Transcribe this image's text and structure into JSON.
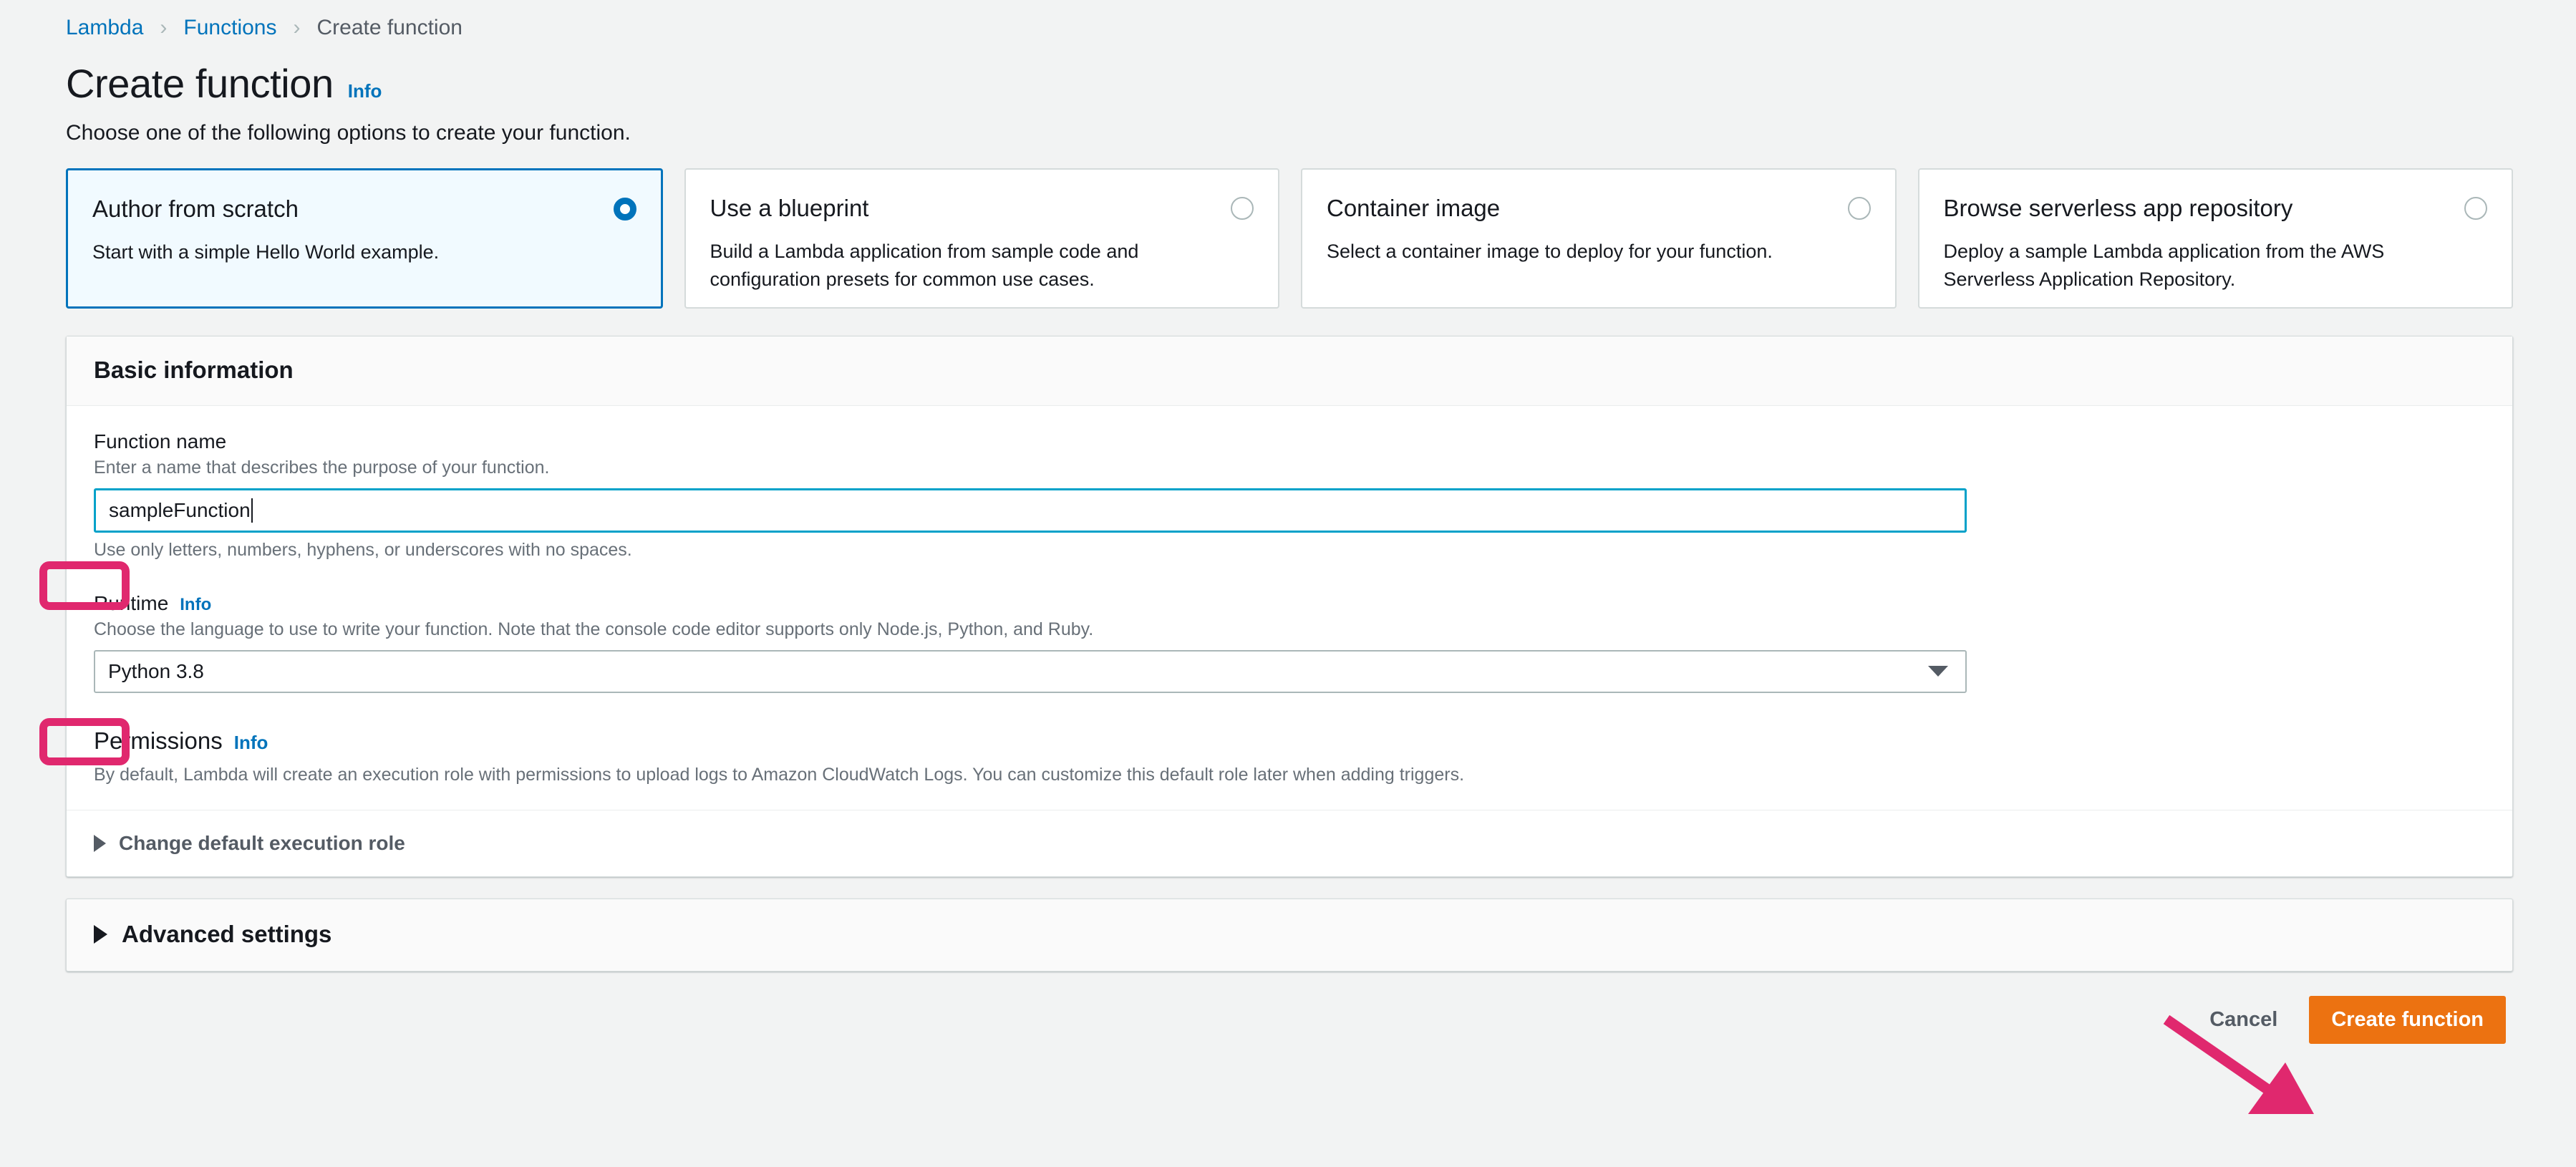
{
  "breadcrumb": {
    "items": [
      {
        "label": "Lambda",
        "current": false
      },
      {
        "label": "Functions",
        "current": false
      },
      {
        "label": "Create function",
        "current": true
      }
    ],
    "separator": "›"
  },
  "header": {
    "title": "Create function",
    "info_label": "Info",
    "subtitle": "Choose one of the following options to create your function."
  },
  "options": [
    {
      "title": "Author from scratch",
      "description": "Start with a simple Hello World example.",
      "selected": true
    },
    {
      "title": "Use a blueprint",
      "description": "Build a Lambda application from sample code and configuration presets for common use cases.",
      "selected": false
    },
    {
      "title": "Container image",
      "description": "Select a container image to deploy for your function.",
      "selected": false
    },
    {
      "title": "Browse serverless app repository",
      "description": "Deploy a sample Lambda application from the AWS Serverless Application Repository.",
      "selected": false
    }
  ],
  "basic_information": {
    "heading": "Basic information",
    "function_name": {
      "label": "Function name",
      "hint": "Enter a name that describes the purpose of your function.",
      "value": "sampleFunction",
      "placeholder": "",
      "constraint": "Use only letters, numbers, hyphens, or underscores with no spaces."
    },
    "runtime": {
      "label": "Runtime",
      "info_label": "Info",
      "hint": "Choose the language to use to write your function. Note that the console code editor supports only Node.js, Python, and Ruby.",
      "selected": "Python 3.8"
    },
    "permissions": {
      "label": "Permissions",
      "info_label": "Info",
      "description": "By default, Lambda will create an execution role with permissions to upload logs to Amazon CloudWatch Logs. You can customize this default role later when adding triggers.",
      "expander_label": "Change default execution role"
    }
  },
  "advanced_settings": {
    "label": "Advanced settings"
  },
  "footer": {
    "cancel_label": "Cancel",
    "create_label": "Create function"
  },
  "colors": {
    "accent_blue": "#0073bb",
    "focus_blue": "#00a1c9",
    "annotation_pink": "#e0286e",
    "primary_orange": "#ec7211",
    "page_background": "#f2f3f3",
    "selected_card_background": "#f1faff"
  }
}
